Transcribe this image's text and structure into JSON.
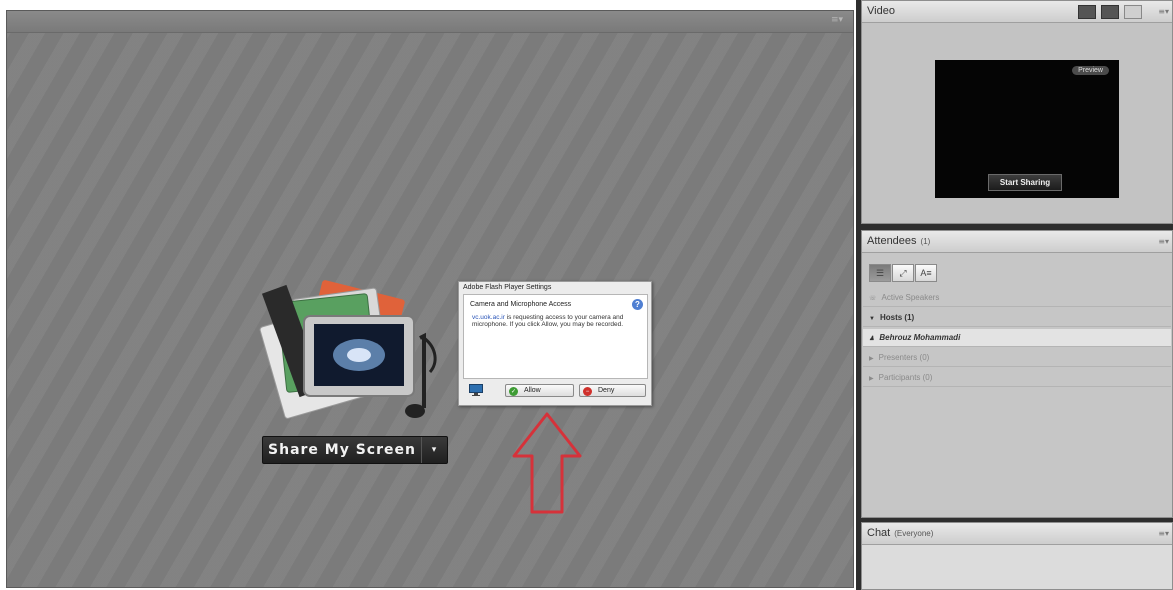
{
  "share_pod": {
    "share_button_label": "Share My Screen",
    "dropdown_glyph": "▾",
    "menu_glyph": "≡▾"
  },
  "flash_dialog": {
    "title": "Adobe Flash Player Settings",
    "heading": "Camera and Microphone Access",
    "message_domain": "vc.uok.ac.ir",
    "message_rest": " is requesting access to your camera and microphone. If you click Allow, you may be recorded.",
    "allow_label": "Allow",
    "deny_label": "Deny",
    "help_glyph": "?"
  },
  "video_pod": {
    "title": "Video",
    "preview_label": "Preview",
    "start_sharing_label": "Start Sharing"
  },
  "attendees_pod": {
    "title": "Attendees",
    "count": "(1)",
    "toolbar": [
      "☰",
      "⤢",
      "A≡"
    ],
    "rows": {
      "active_speakers": "Active Speakers",
      "hosts": "Hosts (1)",
      "host_user": "Behrouz Mohammadi",
      "presenters": "Presenters (0)",
      "participants": "Participants (0)"
    }
  },
  "chat_pod": {
    "title": "Chat",
    "audience": "(Everyone)"
  },
  "colors": {
    "share_pod_bg": "#7d7d7d",
    "arrow_red": "#d6323a",
    "allow_green": "#3e9c34",
    "deny_red": "#d0302b"
  },
  "icons": {
    "pod_menu": "menu-icon",
    "help": "help-icon",
    "monitor": "monitor-icon",
    "allow": "check-icon",
    "deny": "deny-icon",
    "speaker": "speaker-icon",
    "user": "user-icon"
  }
}
